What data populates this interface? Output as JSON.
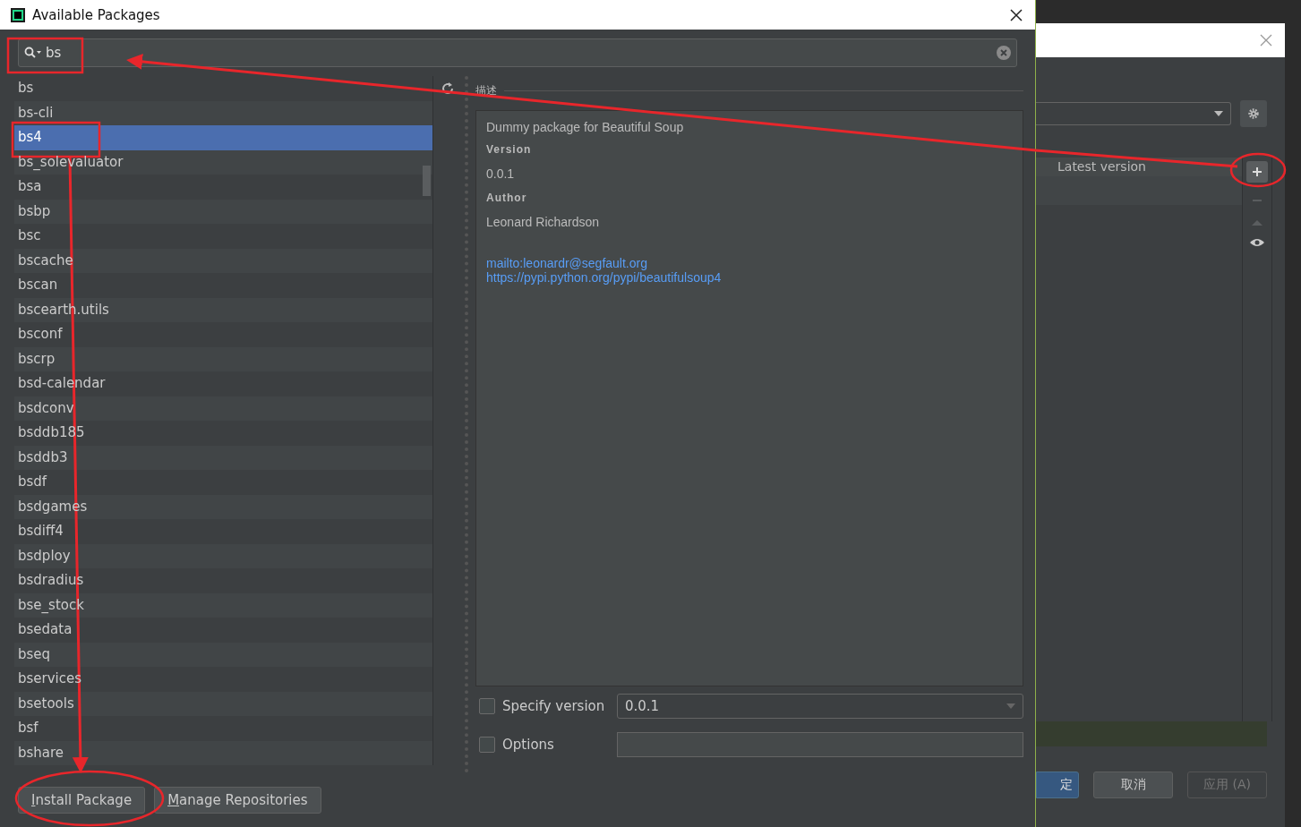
{
  "window": {
    "title": "Available Packages"
  },
  "search": {
    "value": "bs"
  },
  "packages": [
    {
      "name": "bs",
      "selected": false
    },
    {
      "name": "bs-cli",
      "selected": false
    },
    {
      "name": "bs4",
      "selected": true
    },
    {
      "name": "bs_solevaluator",
      "selected": false
    },
    {
      "name": "bsa",
      "selected": false
    },
    {
      "name": "bsbp",
      "selected": false
    },
    {
      "name": "bsc",
      "selected": false
    },
    {
      "name": "bscache",
      "selected": false
    },
    {
      "name": "bscan",
      "selected": false
    },
    {
      "name": "bscearth.utils",
      "selected": false
    },
    {
      "name": "bsconf",
      "selected": false
    },
    {
      "name": "bscrp",
      "selected": false
    },
    {
      "name": "bsd-calendar",
      "selected": false
    },
    {
      "name": "bsdconv",
      "selected": false
    },
    {
      "name": "bsddb185",
      "selected": false
    },
    {
      "name": "bsddb3",
      "selected": false
    },
    {
      "name": "bsdf",
      "selected": false
    },
    {
      "name": "bsdgames",
      "selected": false
    },
    {
      "name": "bsdiff4",
      "selected": false
    },
    {
      "name": "bsdploy",
      "selected": false
    },
    {
      "name": "bsdradius",
      "selected": false
    },
    {
      "name": "bse_stock",
      "selected": false
    },
    {
      "name": "bsedata",
      "selected": false
    },
    {
      "name": "bseq",
      "selected": false
    },
    {
      "name": "bservices",
      "selected": false
    },
    {
      "name": "bsetools",
      "selected": false
    },
    {
      "name": "bsf",
      "selected": false
    },
    {
      "name": "bshare",
      "selected": false
    }
  ],
  "description": {
    "heading": "描述",
    "summary": "Dummy package for Beautiful Soup",
    "fields": [
      {
        "label": "Version",
        "value": "0.0.1"
      },
      {
        "label": "Author",
        "value": "Leonard Richardson"
      }
    ],
    "links": [
      "mailto:leonardr@segfault.org",
      "https://pypi.python.org/pypi/beautifulsoup4"
    ]
  },
  "options": [
    {
      "label": "Specify version",
      "checked": false,
      "kind": "dropdown",
      "value": "0.0.1"
    },
    {
      "label": "Options",
      "checked": false,
      "kind": "text"
    }
  ],
  "buttons": [
    "Install Package",
    "Manage Repositories"
  ],
  "background_dialog": {
    "column": "Latest version",
    "buttons": [
      {
        "label": "定",
        "primary": true,
        "disabled": false
      },
      {
        "label": "取消",
        "primary": false,
        "disabled": false
      },
      {
        "label": "应用 (A)",
        "primary": false,
        "disabled": true
      }
    ]
  }
}
